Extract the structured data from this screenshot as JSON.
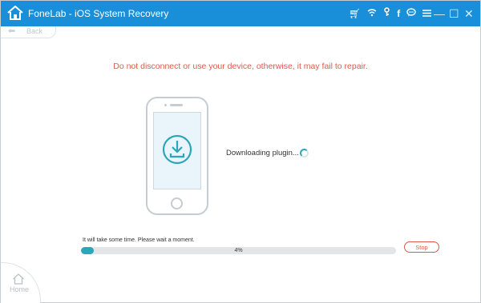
{
  "app": {
    "title": "FoneLab - iOS System Recovery"
  },
  "toolbar": {
    "icons": [
      "cart-icon",
      "wifi-icon",
      "key-icon",
      "facebook-icon",
      "chat-icon",
      "menu-icon"
    ]
  },
  "window_controls": {
    "minimize": "—",
    "maximize": "☐",
    "close": "✕"
  },
  "nav": {
    "back_label": "Back",
    "home_label": "Home"
  },
  "main": {
    "warning": "Do not disconnect or use your device, otherwise, it may fail to repair.",
    "status": "Downloading plugin...",
    "hint": "It will take some time. Please wait a moment.",
    "progress": {
      "label": "4%",
      "value": 0.04
    },
    "stop_label": "Stop"
  },
  "colors": {
    "titlebar": "#1a8fd9",
    "warning": "#e2574c",
    "accent": "#2aa7b8"
  }
}
